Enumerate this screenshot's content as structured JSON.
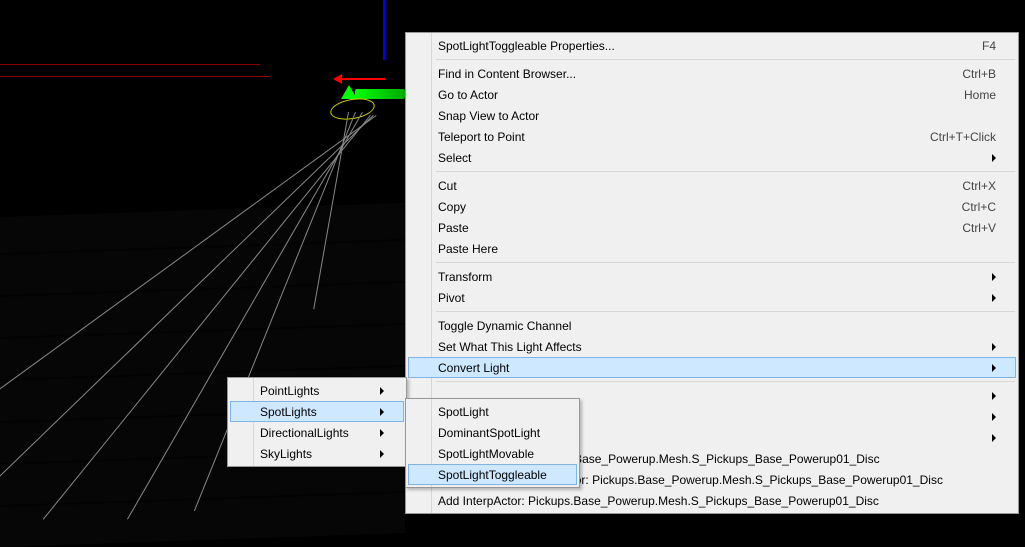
{
  "mainMenu": {
    "g0": [
      {
        "label": "SpotLightToggleable Properties...",
        "shortcut": "F4"
      }
    ],
    "g1": [
      {
        "label": "Find in Content Browser...",
        "shortcut": "Ctrl+B"
      },
      {
        "label": "Go to Actor",
        "shortcut": "Home"
      },
      {
        "label": "Snap View to Actor",
        "shortcut": ""
      },
      {
        "label": "Teleport to Point",
        "shortcut": "Ctrl+T+Click"
      },
      {
        "label": "Select",
        "shortcut": "",
        "sub": true
      }
    ],
    "g2": [
      {
        "label": "Cut",
        "shortcut": "Ctrl+X"
      },
      {
        "label": "Copy",
        "shortcut": "Ctrl+C"
      },
      {
        "label": "Paste",
        "shortcut": "Ctrl+V"
      },
      {
        "label": "Paste Here",
        "shortcut": ""
      }
    ],
    "g3": [
      {
        "label": "Transform",
        "shortcut": "",
        "sub": true
      },
      {
        "label": "Pivot",
        "shortcut": "",
        "sub": true
      }
    ],
    "g4": [
      {
        "label": "Toggle Dynamic Channel",
        "shortcut": ""
      },
      {
        "label": "Set What This Light Affects",
        "shortcut": "",
        "sub": true
      },
      {
        "label": "Convert Light",
        "shortcut": "",
        "sub": true,
        "hl": true
      }
    ],
    "g5": [
      {
        "label": "",
        "shortcut": "",
        "sub": true
      },
      {
        "label": "",
        "shortcut": "",
        "sub": true
      },
      {
        "label": "",
        "shortcut": "",
        "sub": true
      },
      {
        "label": "Add StaticMesh: Pickups.Base_Powerup.Mesh.S_Pickups_Base_Powerup01_Disc",
        "shortcut": ""
      },
      {
        "label": "Add InteractiveFoliageActor: Pickups.Base_Powerup.Mesh.S_Pickups_Base_Powerup01_Disc",
        "shortcut": ""
      },
      {
        "label": "Add InterpActor: Pickups.Base_Powerup.Mesh.S_Pickups_Base_Powerup01_Disc",
        "shortcut": ""
      }
    ]
  },
  "categoriesMenu": [
    {
      "label": "PointLights"
    },
    {
      "label": "SpotLights",
      "hl": true
    },
    {
      "label": "DirectionalLights"
    },
    {
      "label": "SkyLights"
    }
  ],
  "convertMenu": [
    {
      "label": "SpotLight"
    },
    {
      "label": "DominantSpotLight"
    },
    {
      "label": "SpotLightMovable"
    },
    {
      "label": "SpotLightToggleable",
      "hl": true
    }
  ]
}
